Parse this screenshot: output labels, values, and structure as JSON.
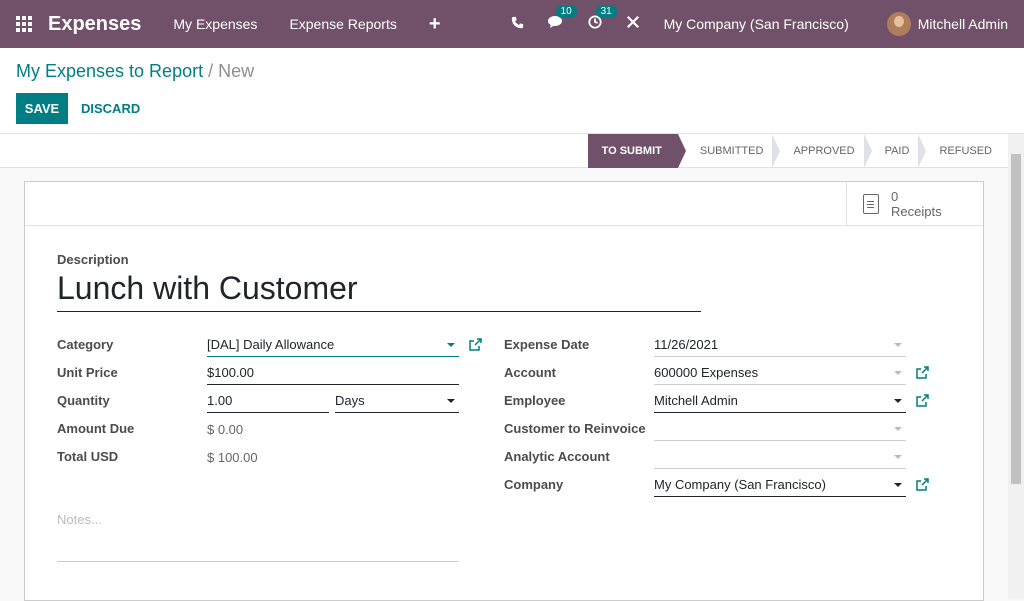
{
  "navbar": {
    "app_title": "Expenses",
    "menu": [
      "My Expenses",
      "Expense Reports"
    ],
    "plus": "+",
    "messages_badge": "10",
    "activity_badge": "31",
    "company": "My Company (San Francisco)",
    "user": "Mitchell Admin"
  },
  "breadcrumb": {
    "parent": "My Expenses to Report",
    "sep": "/",
    "current": "New"
  },
  "buttons": {
    "save": "SAVE",
    "discard": "DISCARD"
  },
  "stages": [
    "TO SUBMIT",
    "SUBMITTED",
    "APPROVED",
    "PAID",
    "REFUSED"
  ],
  "receipts": {
    "count": "0",
    "label": "Receipts"
  },
  "form": {
    "description_label": "Description",
    "description": "Lunch with Customer",
    "left": {
      "category_label": "Category",
      "category": "[DAL] Daily Allowance",
      "unit_price_label": "Unit Price",
      "unit_price": "$100.00",
      "quantity_label": "Quantity",
      "quantity": "1.00",
      "uom": "Days",
      "amount_due_label": "Amount Due",
      "amount_due": "$ 0.00",
      "total_label": "Total USD",
      "total": "$ 100.00"
    },
    "right": {
      "date_label": "Expense Date",
      "date": "11/26/2021",
      "account_label": "Account",
      "account": "600000 Expenses",
      "employee_label": "Employee",
      "employee": "Mitchell Admin",
      "reinvoice_label": "Customer to Reinvoice",
      "reinvoice": "",
      "analytic_label": "Analytic Account",
      "analytic": "",
      "company_label": "Company",
      "company": "My Company (San Francisco)"
    },
    "notes_placeholder": "Notes..."
  },
  "colors": {
    "brand": "#71516a",
    "accent": "#017e84"
  }
}
